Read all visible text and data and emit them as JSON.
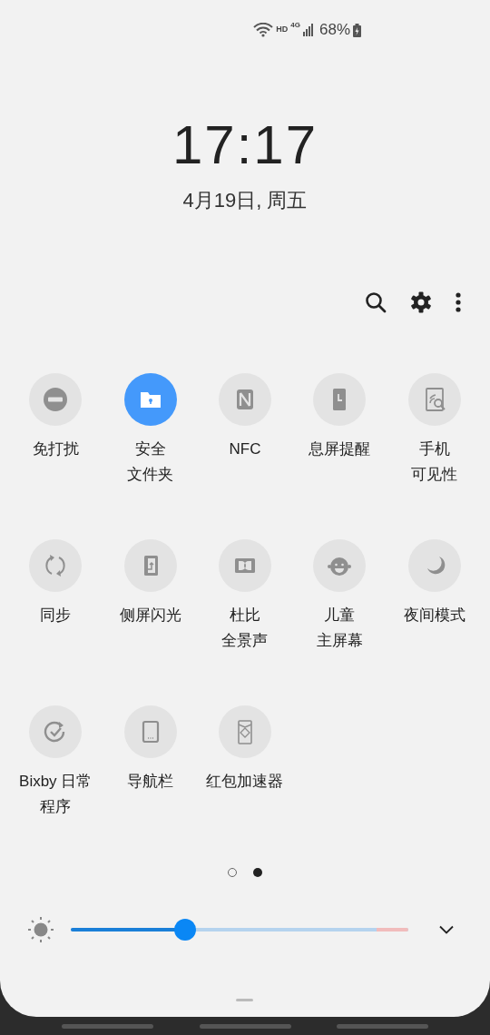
{
  "status_bar": {
    "network": "HD",
    "cellular": "4G",
    "battery": "68%"
  },
  "clock": {
    "time": "17:17",
    "date": "4月19日, 周五"
  },
  "tiles": [
    {
      "label_lines": [
        "免打扰"
      ],
      "on": false
    },
    {
      "label_lines": [
        "安全",
        "文件夹"
      ],
      "on": true
    },
    {
      "label_lines": [
        "NFC"
      ],
      "on": false
    },
    {
      "label_lines": [
        "息屏提醒"
      ],
      "on": false
    },
    {
      "label_lines": [
        "手机",
        "可见性"
      ],
      "on": false
    },
    {
      "label_lines": [
        "同步"
      ],
      "on": false
    },
    {
      "label_lines": [
        "侧屏闪光"
      ],
      "on": false
    },
    {
      "label_lines": [
        "杜比",
        "全景声"
      ],
      "on": false
    },
    {
      "label_lines": [
        "儿童",
        "主屏幕"
      ],
      "on": false
    },
    {
      "label_lines": [
        "夜间模式"
      ],
      "on": false
    },
    {
      "label_lines": [
        "Bixby 日常",
        "程序"
      ],
      "on": false
    },
    {
      "label_lines": [
        "导航栏"
      ],
      "on": false
    },
    {
      "label_lines": [
        "红包加速器"
      ],
      "on": false
    }
  ],
  "pages": [
    {
      "selected": false
    },
    {
      "selected": true
    }
  ],
  "brightness": {
    "level": 0.34
  }
}
